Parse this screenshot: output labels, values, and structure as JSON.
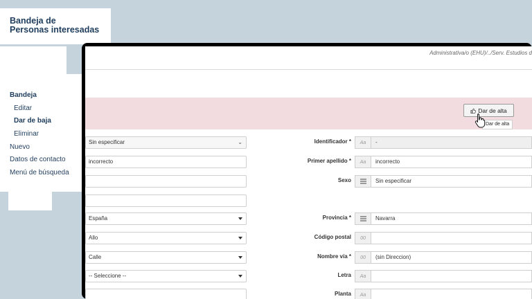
{
  "callout": {
    "title_line1": "Bandeja de",
    "title_line2": "Personas  interesadas"
  },
  "menu": {
    "bandeja": "Bandeja",
    "editar": "Editar",
    "dar_de_baja": "Dar de baja",
    "eliminar": "Eliminar",
    "nuevo": "Nuevo",
    "datos_contacto": "Datos de contacto",
    "menu_busqueda": "Menú de búsqueda"
  },
  "app": {
    "path": "Administrativa/o (EHU)/../Serv. Estudios d"
  },
  "toolbar": {
    "alta_label": "Dar de alta",
    "tooltip": "Dar de alta"
  },
  "left_fields": {
    "tipo": "Sin especificar",
    "apellido_partial": "incorrecto",
    "blank1": "",
    "blank2": "",
    "pais": "España",
    "municipio": "Allo",
    "tipo_via": "Calle",
    "seleccione": "-- Seleccione --"
  },
  "right_fields": {
    "identificador_label": "Identificador *",
    "identificador_adorn": "Aa",
    "identificador_value": "-",
    "primer_apellido_label": "Primer apellido *",
    "primer_apellido_adorn": "Aa",
    "primer_apellido_value": "incorrecto",
    "sexo_label": "Sexo",
    "sexo_value": "Sin especificar",
    "provincia_label": "Provincia *",
    "provincia_value": "Navarra",
    "codigo_postal_label": "Código postal",
    "codigo_postal_adorn": "00",
    "codigo_postal_value": "",
    "nombre_via_label": "Nombre vía *",
    "nombre_via_adorn": "00",
    "nombre_via_value": "(sin Direccion)",
    "letra_label": "Letra",
    "letra_adorn": "Aa",
    "letra_value": "",
    "planta_label": "Planta",
    "planta_adorn": "Aa"
  },
  "colors": {
    "background": "#c5d3dc",
    "toolbar_band": "#f2dce0",
    "menu_text": "#1f3d5c"
  }
}
